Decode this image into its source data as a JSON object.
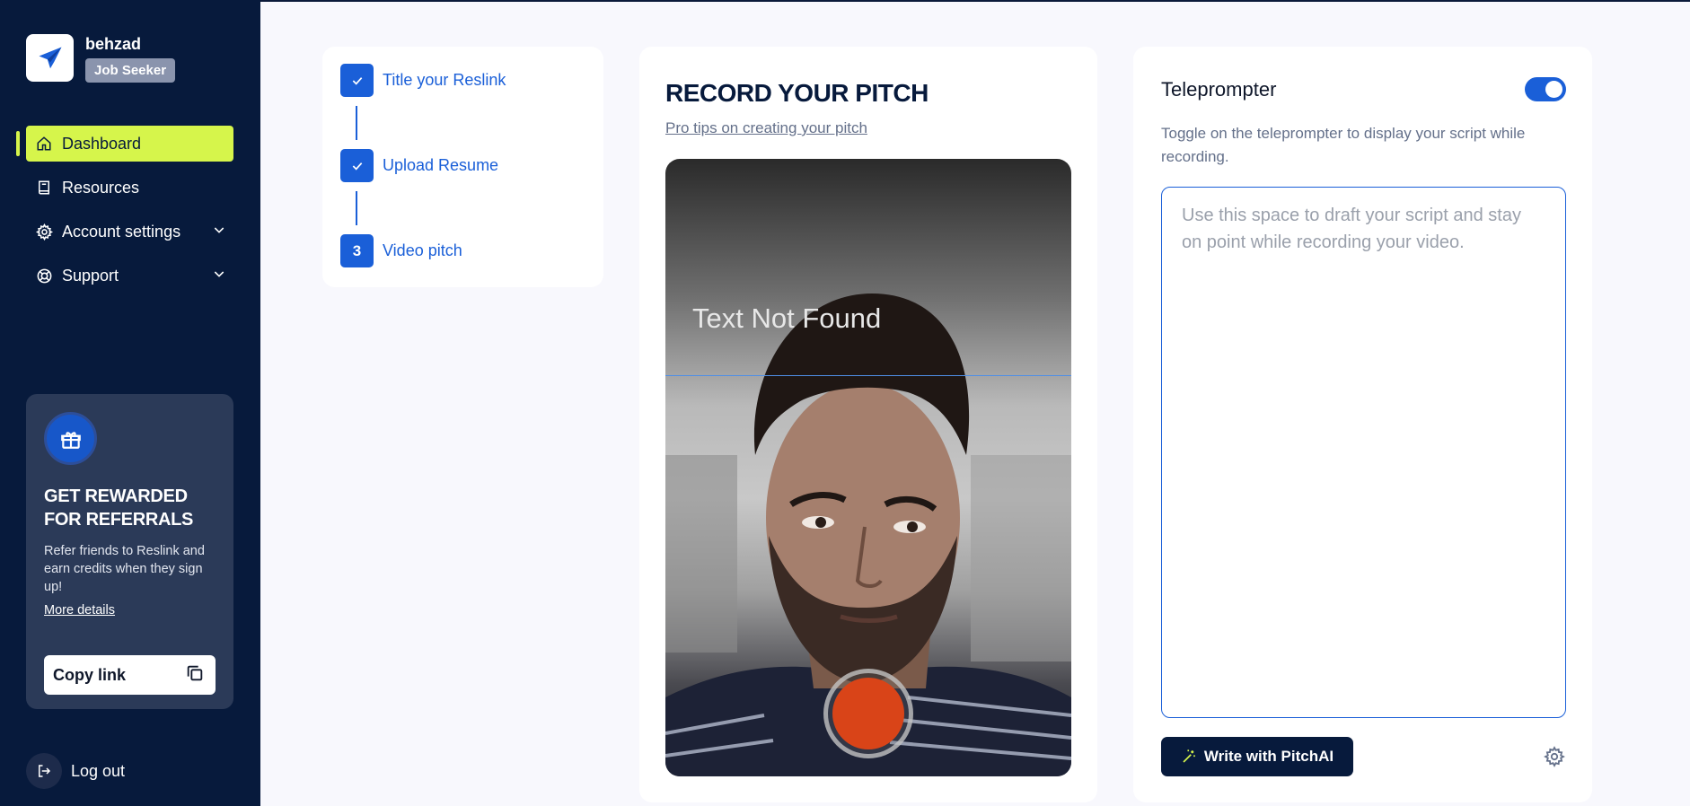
{
  "user": {
    "name": "behzad",
    "role": "Job Seeker"
  },
  "sidebar": {
    "items": [
      {
        "label": "Dashboard",
        "icon": "home-icon",
        "active": true
      },
      {
        "label": "Resources",
        "icon": "book-icon"
      },
      {
        "label": "Account settings",
        "icon": "gear-icon",
        "expandable": true
      },
      {
        "label": "Support",
        "icon": "lifebuoy-icon",
        "expandable": true
      }
    ],
    "logout_label": "Log out"
  },
  "referral": {
    "title": "GET REWARDED FOR REFERRALS",
    "description": "Refer friends to Reslink and earn credits when they sign up!",
    "link_label": "More details",
    "copy_label": "Copy link"
  },
  "steps": [
    {
      "label": "Title your Reslink",
      "status": "done"
    },
    {
      "label": "Upload Resume",
      "status": "done"
    },
    {
      "label": "Video pitch",
      "status": "current",
      "number": "3"
    }
  ],
  "record": {
    "title": "RECORD YOUR PITCH",
    "tips_link": "Pro tips on creating your pitch",
    "overlay_text": "Text Not Found"
  },
  "teleprompter": {
    "title": "Teleprompter",
    "enabled": true,
    "description": "Toggle on the teleprompter to display your script while recording.",
    "placeholder": "Use this space to draft your script and stay on point while recording your video.",
    "value": "",
    "write_button": "Write with PitchAI"
  },
  "colors": {
    "sidebar_bg": "#071a3c",
    "accent_lime": "#d6f54b",
    "primary_blue": "#1a5fd8",
    "record_red": "#d94418"
  }
}
